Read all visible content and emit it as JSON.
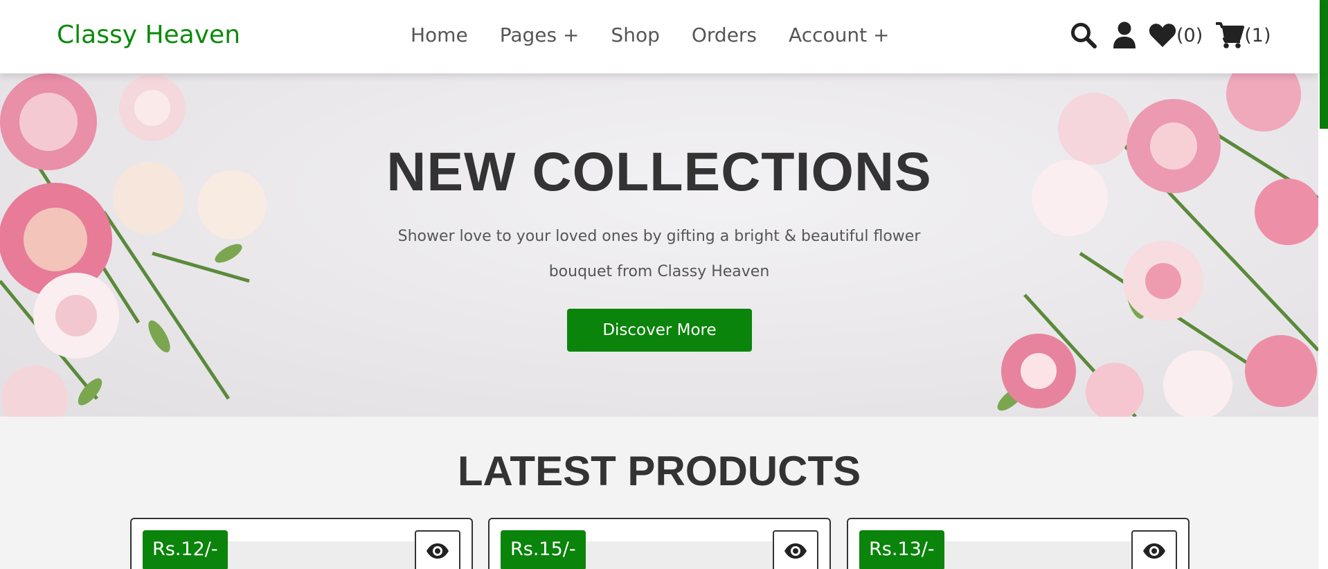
{
  "brand": {
    "name": "Classy Heaven",
    "color": "#0a8a0a"
  },
  "nav": {
    "items": [
      {
        "label": "Home"
      },
      {
        "label": "Pages +"
      },
      {
        "label": "Shop"
      },
      {
        "label": "Orders"
      },
      {
        "label": "Account +"
      }
    ]
  },
  "header_icons": {
    "search": "search-icon",
    "account": "user-icon",
    "wishlist": {
      "icon": "heart-icon",
      "count": "(0)"
    },
    "cart": {
      "icon": "cart-icon",
      "count": "(1)"
    }
  },
  "hero": {
    "title": "NEW COLLECTIONS",
    "text": "Shower love to your loved ones by gifting a bright & beautiful flower bouquet from Classy Heaven",
    "button": "Discover More"
  },
  "latest": {
    "title": "LATEST PRODUCTS",
    "products": [
      {
        "price": "Rs.12/-",
        "view_icon": "eye-icon"
      },
      {
        "price": "Rs.15/-",
        "view_icon": "eye-icon"
      },
      {
        "price": "Rs.13/-",
        "view_icon": "eye-icon"
      }
    ]
  },
  "colors": {
    "accent": "#0a840a",
    "text_dark": "#333333",
    "text_muted": "#555555"
  }
}
